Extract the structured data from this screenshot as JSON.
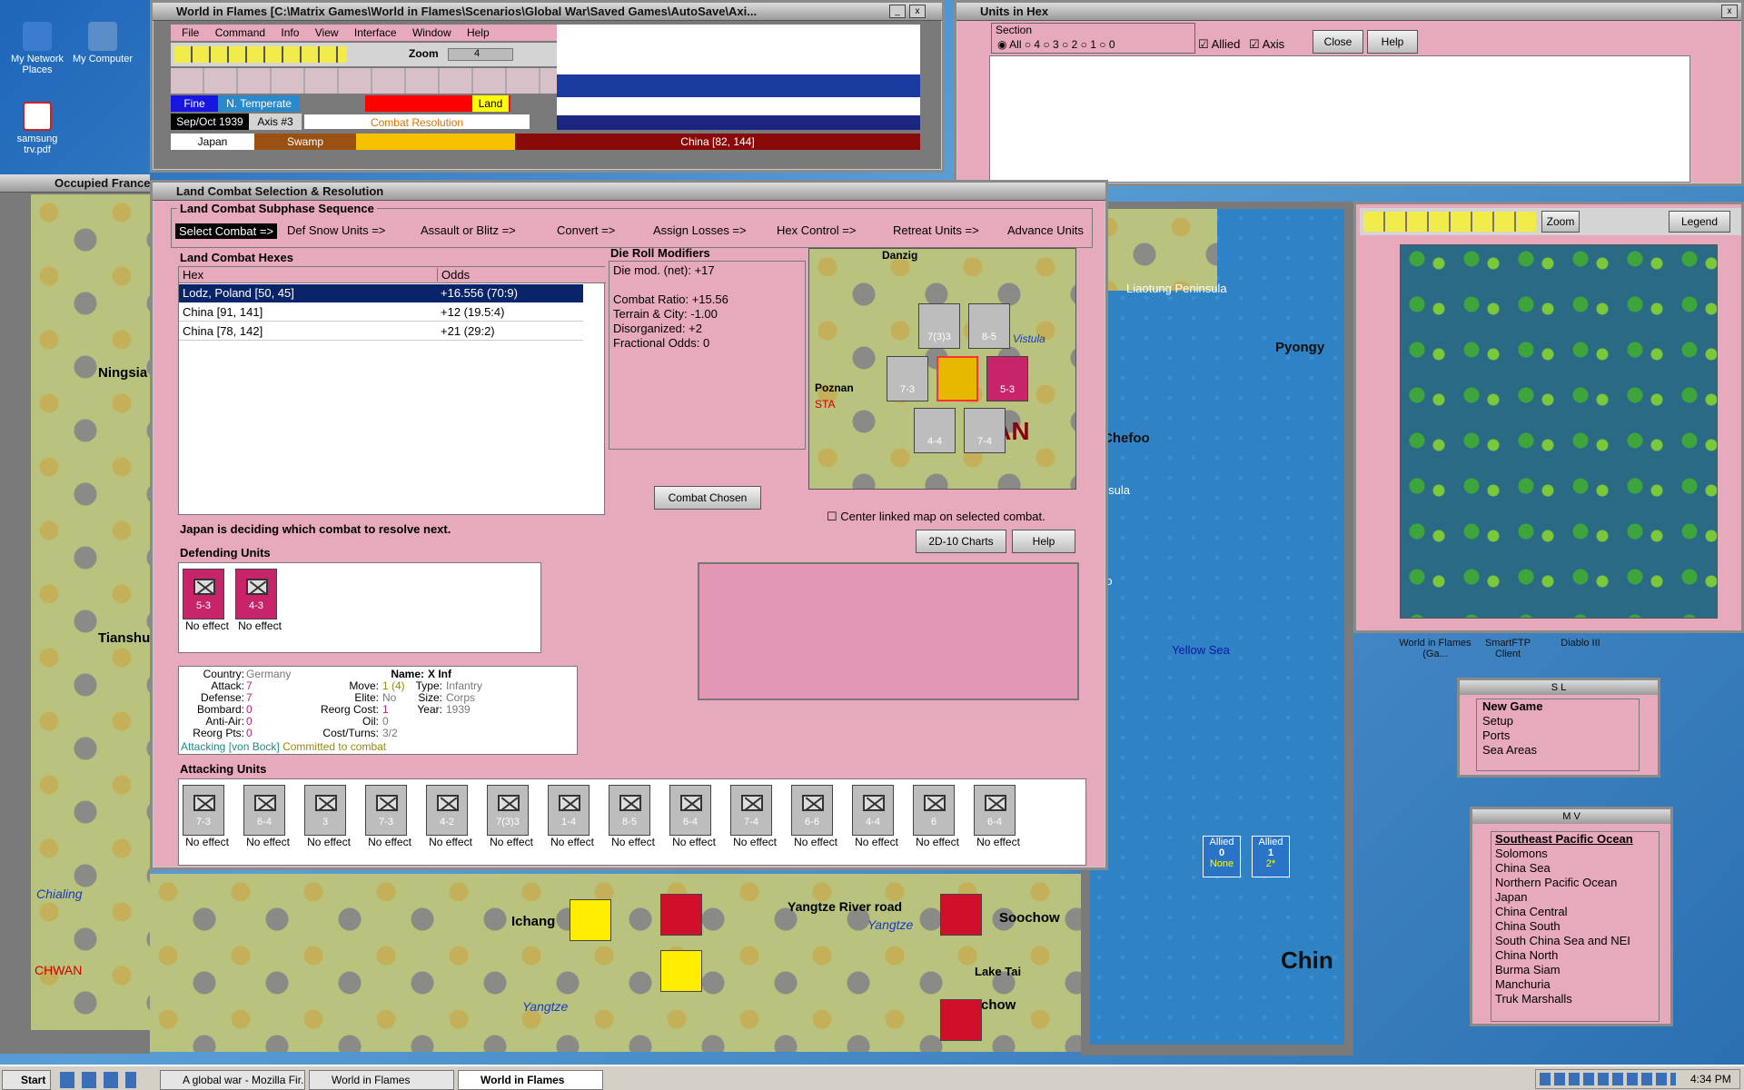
{
  "desktop": {
    "icons": [
      {
        "label": "My Network Places"
      },
      {
        "label": "My Computer"
      },
      {
        "label": "samsung trv.pdf"
      }
    ]
  },
  "main_window": {
    "title": "World in Flames [C:\\Matrix Games\\World in Flames\\Scenarios\\Global War\\Saved Games\\AutoSave\\Axi...",
    "menu": [
      "File",
      "Command",
      "Info",
      "View",
      "Interface",
      "Window",
      "Help"
    ],
    "zoom_label": "Zoom",
    "zoom_value": "4",
    "weather": "Fine",
    "climate": "N. Temperate",
    "terrain_type": "Land",
    "date": "Sep/Oct 1939",
    "impulse": "Axis #3",
    "phase": "Combat Resolution",
    "country": "Japan",
    "terrain": "Swamp",
    "location": "China [82, 144]"
  },
  "units_in_hex": {
    "title": "Units in Hex",
    "section_label": "Section",
    "options": [
      "All",
      "4",
      "3",
      "2",
      "1",
      "0"
    ],
    "allied_label": "Allied",
    "axis_label": "Axis",
    "close_label": "Close",
    "help_label": "Help"
  },
  "occupied_label": "Occupied France",
  "combat_dialog": {
    "title": "Land Combat Selection & Resolution",
    "subphase_title": "Land Combat Subphase Sequence",
    "subphases": [
      "Select Combat =>",
      "Def Snow Units =>",
      "Assault or Blitz =>",
      "Convert =>",
      "Assign Losses =>",
      "Hex Control =>",
      "Retreat Units =>",
      "Advance Units"
    ],
    "hexes_title": "Land Combat Hexes",
    "col_hex": "Hex",
    "col_odds": "Odds",
    "rows": [
      {
        "hex": "Lodz, Poland [50, 45]",
        "odds": "+16.556 (70:9)"
      },
      {
        "hex": "China [91, 141]",
        "odds": "+12 (19.5:4)"
      },
      {
        "hex": "China [78, 142]",
        "odds": "+21 (29:2)"
      }
    ],
    "modifiers_title": "Die Roll Modifiers",
    "modifiers": [
      "Die mod. (net): +17",
      "",
      "Combat Ratio: +15.56",
      "Terrain & City: -1.00",
      "Disorganized: +2",
      "Fractional Odds: 0"
    ],
    "combat_chosen": "Combat Chosen",
    "center_linked": "Center linked map on selected combat.",
    "charts_btn": "2D-10 Charts",
    "help_btn": "Help",
    "status": "Japan is deciding which combat to resolve next.",
    "defending_title": "Defending Units",
    "defenders": [
      {
        "strength": "5-3",
        "effect": "No effect"
      },
      {
        "strength": "4-3",
        "effect": "No effect"
      }
    ],
    "unit_info": {
      "country_label": "Country:",
      "country": "Germany",
      "attack_label": "Attack:",
      "attack": "7",
      "defense_label": "Defense:",
      "defense": "7",
      "bombard_label": "Bombard:",
      "bombard": "0",
      "antiair_label": "Anti-Air:",
      "antiair": "0",
      "reorg_label": "Reorg Pts:",
      "reorg": "0",
      "move_label": "Move:",
      "move": "1 (4)",
      "elite_label": "Elite:",
      "elite": "No",
      "reorgcost_label": "Reorg Cost:",
      "reorgcost": "1",
      "oil_label": "Oil:",
      "oil": "0",
      "cost_label": "Cost/Turns:",
      "cost": "3/2",
      "name_label": "Name:",
      "name": "X Inf",
      "type_label": "Type:",
      "type": "Infantry",
      "size_label": "Size:",
      "size": "Corps",
      "year_label": "Year:",
      "year": "1939",
      "attacking": "Attacking [von Bock]",
      "committed": "Committed to combat"
    },
    "attacking_title": "Attacking Units",
    "attackers": [
      {
        "strength": "7-3",
        "effect": "No effect"
      },
      {
        "strength": "6-4",
        "effect": "No effect"
      },
      {
        "strength": "3",
        "effect": "No effect"
      },
      {
        "strength": "7-3",
        "effect": "No effect"
      },
      {
        "strength": "4-2",
        "effect": "No effect"
      },
      {
        "strength": "7(3)3",
        "effect": "No effect"
      },
      {
        "strength": "1-4",
        "effect": "No effect"
      },
      {
        "strength": "8-5",
        "effect": "No effect"
      },
      {
        "strength": "6-4",
        "effect": "No effect"
      },
      {
        "strength": "7-4",
        "effect": "No effect"
      },
      {
        "strength": "6-6",
        "effect": "No effect"
      },
      {
        "strength": "4-4",
        "effect": "No effect"
      },
      {
        "strength": "6",
        "effect": "No effect"
      },
      {
        "strength": "6-4",
        "effect": "No effect"
      }
    ],
    "mini_map_labels": [
      "Danzig",
      "Poznan",
      "LAN",
      "Vistula",
      "STA"
    ],
    "mini_counters": [
      "7(3)3",
      "8-5",
      "7-3",
      "5-3",
      "4-4",
      "7-4"
    ]
  },
  "left_map": {
    "places": [
      "Ningsia",
      "Tianshui",
      "Chialing",
      "CHWAN"
    ]
  },
  "right_map": {
    "places": [
      "Liaotung Peninsula",
      "Pyongy",
      "Chefoo",
      "insula",
      "ao",
      "Yellow Sea",
      "Ichang",
      "Yangtze River road",
      "Yangtze",
      "Soochow",
      "Lake Tai",
      "chow",
      "Chin",
      "Yangtze",
      "Lake"
    ],
    "allied_boxes": [
      {
        "label": "Allied",
        "value": "0",
        "sub": "None"
      },
      {
        "label": "Allied",
        "value": "1",
        "sub": "2*"
      }
    ]
  },
  "overview": {
    "zoom": "Zoom",
    "legend": "Legend"
  },
  "apps": [
    "World in Flames (Ga...",
    "SmartFTP Client",
    "Diablo III"
  ],
  "sl_window": {
    "title": "S L",
    "items": [
      "New Game",
      "Setup",
      "Ports",
      "Sea Areas"
    ]
  },
  "mv_window": {
    "title": "M V",
    "items": [
      "Southeast Pacific Ocean",
      "Solomons",
      "China Sea",
      "Northern Pacific Ocean",
      "Japan",
      "China Central",
      "China South",
      "South China Sea and NEI",
      "China North",
      "Burma Siam",
      "Manchuria",
      "Truk Marshalls"
    ]
  },
  "taskbar": {
    "start": "Start",
    "tasks": [
      "A global war - Mozilla Fir...",
      "World in Flames",
      "World in Flames"
    ],
    "clock": "4:34 PM"
  }
}
